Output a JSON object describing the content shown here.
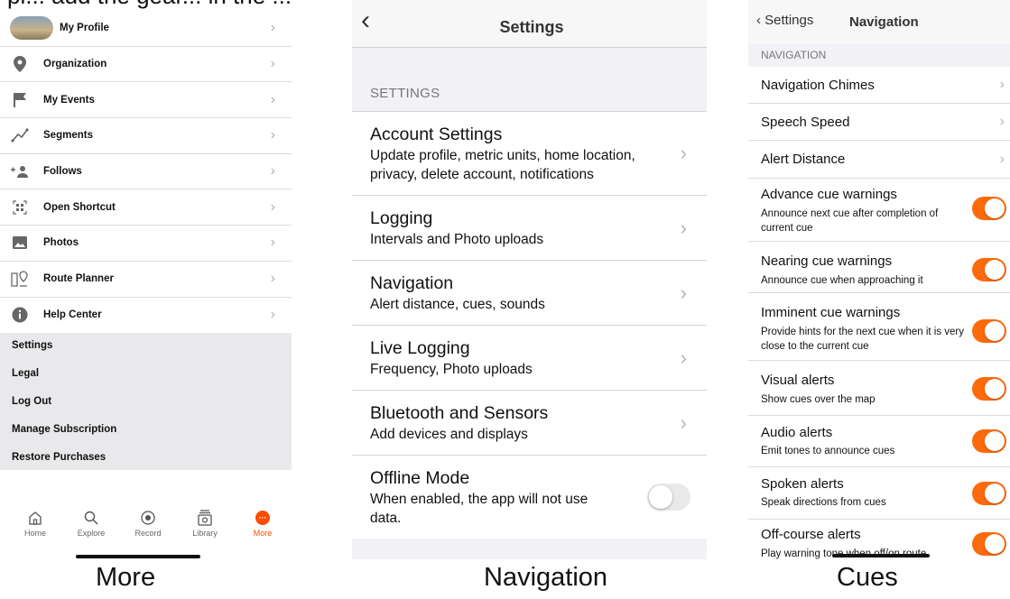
{
  "more": {
    "top_cut_text": "pl... add the gear... in the ... My ... There is ... ",
    "items": [
      {
        "label": "My Profile",
        "icon": "avatar"
      },
      {
        "label": "Organization",
        "icon": "location-pin-icon"
      },
      {
        "label": "My Events",
        "icon": "flag-icon"
      },
      {
        "label": "Segments",
        "icon": "segments-icon"
      },
      {
        "label": "Follows",
        "icon": "add-person-icon"
      },
      {
        "label": "Open Shortcut",
        "icon": "qr-code-icon"
      },
      {
        "label": "Photos",
        "icon": "photo-icon"
      },
      {
        "label": "Route Planner",
        "icon": "route-planner-icon"
      },
      {
        "label": "Help Center",
        "icon": "info-icon"
      }
    ],
    "secondary": [
      "Settings",
      "Legal",
      "Log Out",
      "Manage Subscription",
      "Restore Purchases"
    ],
    "tabs": [
      {
        "label": "Home"
      },
      {
        "label": "Explore"
      },
      {
        "label": "Record"
      },
      {
        "label": "Library"
      },
      {
        "label": "More"
      }
    ],
    "accent": "#fc4c02"
  },
  "settings": {
    "title": "Settings",
    "section": "SETTINGS",
    "rows": [
      {
        "title": "Account Settings",
        "subtitle": "Update profile, metric units, home location, privacy, delete account, notifications"
      },
      {
        "title": "Logging",
        "subtitle": "Intervals and Photo uploads"
      },
      {
        "title": "Navigation",
        "subtitle": "Alert distance, cues, sounds"
      },
      {
        "title": "Live Logging",
        "subtitle": "Frequency, Photo uploads"
      },
      {
        "title": "Bluetooth and Sensors",
        "subtitle": "Add devices and displays"
      },
      {
        "title": "Offline Mode",
        "subtitle": "When enabled, the app will not use data.",
        "toggle": false
      }
    ]
  },
  "cues": {
    "back_label": "Settings",
    "title": "Navigation",
    "section": "NAVIGATION",
    "link_rows": [
      "Navigation Chimes",
      "Speech Speed",
      "Alert Distance"
    ],
    "toggle_rows": [
      {
        "title": "Advance cue warnings",
        "subtitle": "Announce next cue after completion of current cue",
        "on": true
      },
      {
        "title": "Nearing cue warnings",
        "subtitle": "Announce cue when approaching it",
        "on": true
      },
      {
        "title": "Imminent cue warnings",
        "subtitle": "Provide hints for the next cue when it is very close to the current cue",
        "on": true
      },
      {
        "title": "Visual alerts",
        "subtitle": "Show cues over the map",
        "on": true
      },
      {
        "title": "Audio alerts",
        "subtitle": "Emit tones to announce cues",
        "on": true
      },
      {
        "title": "Spoken alerts",
        "subtitle": "Speak directions from cues",
        "on": true
      },
      {
        "title": "Off-course alerts",
        "subtitle": "Play warning tone when off/on route",
        "on": true
      }
    ],
    "toggle_color": "#fc6a0c"
  },
  "captions": {
    "left": "More",
    "middle": "Navigation",
    "right": "Cues"
  }
}
